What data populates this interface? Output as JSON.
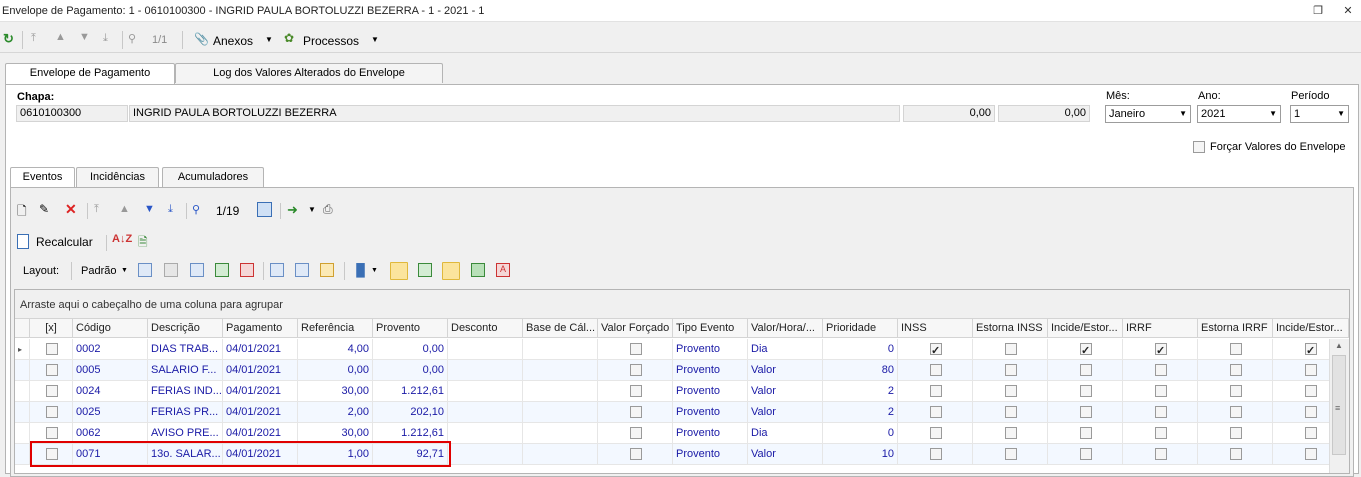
{
  "window": {
    "title": "Envelope de Pagamento: 1 - 0610100300 - INGRID PAULA BORTOLUZZI BEZERRA - 1 - 2021 - 1"
  },
  "toolbar": {
    "counter": "1/1",
    "anexos": "Anexos",
    "processos": "Processos"
  },
  "tabs_top": [
    "Envelope de Pagamento",
    "Log dos Valores Alterados do Envelope"
  ],
  "header": {
    "chapa_label": "Chapa:",
    "chapa": "0610100300",
    "nome": "INGRID PAULA BORTOLUZZI BEZERRA",
    "valor1": "0,00",
    "valor2": "0,00",
    "mes_label": "Mês:",
    "mes": "Janeiro",
    "ano_label": "Ano:",
    "ano": "2021",
    "periodo_label": "Período",
    "periodo": "1",
    "forcar": "Forçar Valores do Envelope"
  },
  "tabs_inner": [
    "Eventos",
    "Incidências",
    "Acumuladores"
  ],
  "toolbar2": {
    "counter": "1/19"
  },
  "toolbar3": {
    "recalcular": "Recalcular"
  },
  "toolbar4": {
    "layout_label": "Layout:",
    "layout_value": "Padrão"
  },
  "grid": {
    "group_hint": "Arraste aqui o cabeçalho de uma coluna para agrupar",
    "columns": [
      "[x]",
      "Código",
      "Descrição",
      "Pagamento",
      "Referência",
      "Provento",
      "Desconto",
      "Base de Cál...",
      "Valor Forçado",
      "Tipo Evento",
      "Valor/Hora/...",
      "Prioridade",
      "INSS",
      "Estorna INSS",
      "Incide/Estor...",
      "IRRF",
      "Estorna IRRF",
      "Incide/Estor..."
    ],
    "rows": [
      {
        "codigo": "0002",
        "descricao": "DIAS TRAB...",
        "pagamento": "04/01/2021",
        "referencia": "4,00",
        "provento": "0,00",
        "tipo": "Provento",
        "vh": "Dia",
        "prioridade": "0",
        "inss": true,
        "inc1": true,
        "irrf": true,
        "inc2": true
      },
      {
        "codigo": "0005",
        "descricao": "SALARIO F...",
        "pagamento": "04/01/2021",
        "referencia": "0,00",
        "provento": "0,00",
        "tipo": "Provento",
        "vh": "Valor",
        "prioridade": "80",
        "inss": false,
        "inc1": false,
        "irrf": false,
        "inc2": false
      },
      {
        "codigo": "0024",
        "descricao": "FERIAS IND...",
        "pagamento": "04/01/2021",
        "referencia": "30,00",
        "provento": "1.212,61",
        "tipo": "Provento",
        "vh": "Valor",
        "prioridade": "2",
        "inss": false,
        "inc1": false,
        "irrf": false,
        "inc2": false
      },
      {
        "codigo": "0025",
        "descricao": "FERIAS PR...",
        "pagamento": "04/01/2021",
        "referencia": "2,00",
        "provento": "202,10",
        "tipo": "Provento",
        "vh": "Valor",
        "prioridade": "2",
        "inss": false,
        "inc1": false,
        "irrf": false,
        "inc2": false
      },
      {
        "codigo": "0062",
        "descricao": "AVISO PRE...",
        "pagamento": "04/01/2021",
        "referencia": "30,00",
        "provento": "1.212,61",
        "tipo": "Provento",
        "vh": "Dia",
        "prioridade": "0",
        "inss": false,
        "inc1": false,
        "irrf": false,
        "inc2": false
      },
      {
        "codigo": "0071",
        "descricao": "13o. SALAR...",
        "pagamento": "04/01/2021",
        "referencia": "1,00",
        "provento": "92,71",
        "tipo": "Provento",
        "vh": "Valor",
        "prioridade": "10",
        "inss": false,
        "inc1": false,
        "irrf": false,
        "inc2": false
      }
    ]
  },
  "colors": {
    "highlight": "#e00000",
    "link_text": "#1a1aa6",
    "active_btn": "#fbe49d"
  }
}
